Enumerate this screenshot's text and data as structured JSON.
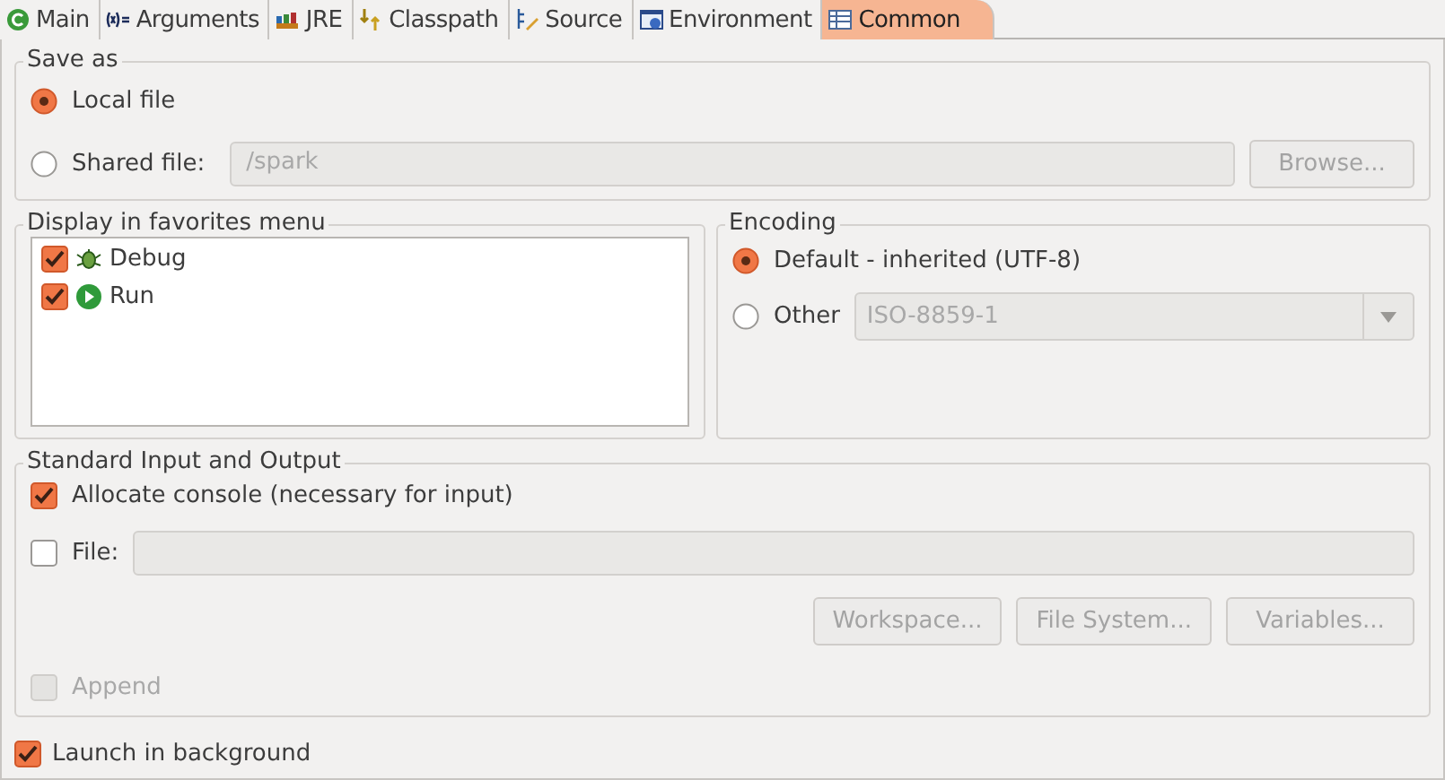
{
  "tabs": [
    {
      "label": "Main",
      "kind": "main",
      "selected": false
    },
    {
      "label": "Arguments",
      "kind": "arguments",
      "selected": false
    },
    {
      "label": "JRE",
      "kind": "jre",
      "selected": false
    },
    {
      "label": "Classpath",
      "kind": "classpath",
      "selected": false
    },
    {
      "label": "Source",
      "kind": "source",
      "selected": false
    },
    {
      "label": "Environment",
      "kind": "environment",
      "selected": false
    },
    {
      "label": "Common",
      "kind": "common",
      "selected": true
    }
  ],
  "save_as": {
    "title": "Save as",
    "options": [
      {
        "label": "Local file",
        "selected": true
      },
      {
        "label": "Shared file:",
        "selected": false
      }
    ],
    "shared_path": {
      "value": "/spark",
      "disabled": true
    },
    "browse_button": {
      "label": "Browse...",
      "disabled": true
    }
  },
  "favorites": {
    "title": "Display in favorites menu",
    "items": [
      {
        "label": "Debug",
        "kind": "debug",
        "checked": true
      },
      {
        "label": "Run",
        "kind": "run",
        "checked": true
      }
    ]
  },
  "encoding": {
    "title": "Encoding",
    "options": [
      {
        "label": "Default - inherited (UTF-8)",
        "selected": true
      },
      {
        "label": "Other",
        "selected": false
      }
    ],
    "other_select": {
      "value": "ISO-8859-1",
      "disabled": true
    }
  },
  "io": {
    "title": "Standard Input and Output",
    "allocate": {
      "label": "Allocate console (necessary for input)",
      "checked": true
    },
    "file": {
      "label": "File:",
      "checked": false
    },
    "file_field": {
      "disabled": true
    },
    "buttons": [
      {
        "label": "Workspace...",
        "disabled": true
      },
      {
        "label": "File System...",
        "disabled": true
      },
      {
        "label": "Variables...",
        "disabled": true
      }
    ],
    "append": {
      "label": "Append",
      "checked": false,
      "disabled": true
    }
  },
  "launch": {
    "label": "Launch in background",
    "checked": true
  }
}
